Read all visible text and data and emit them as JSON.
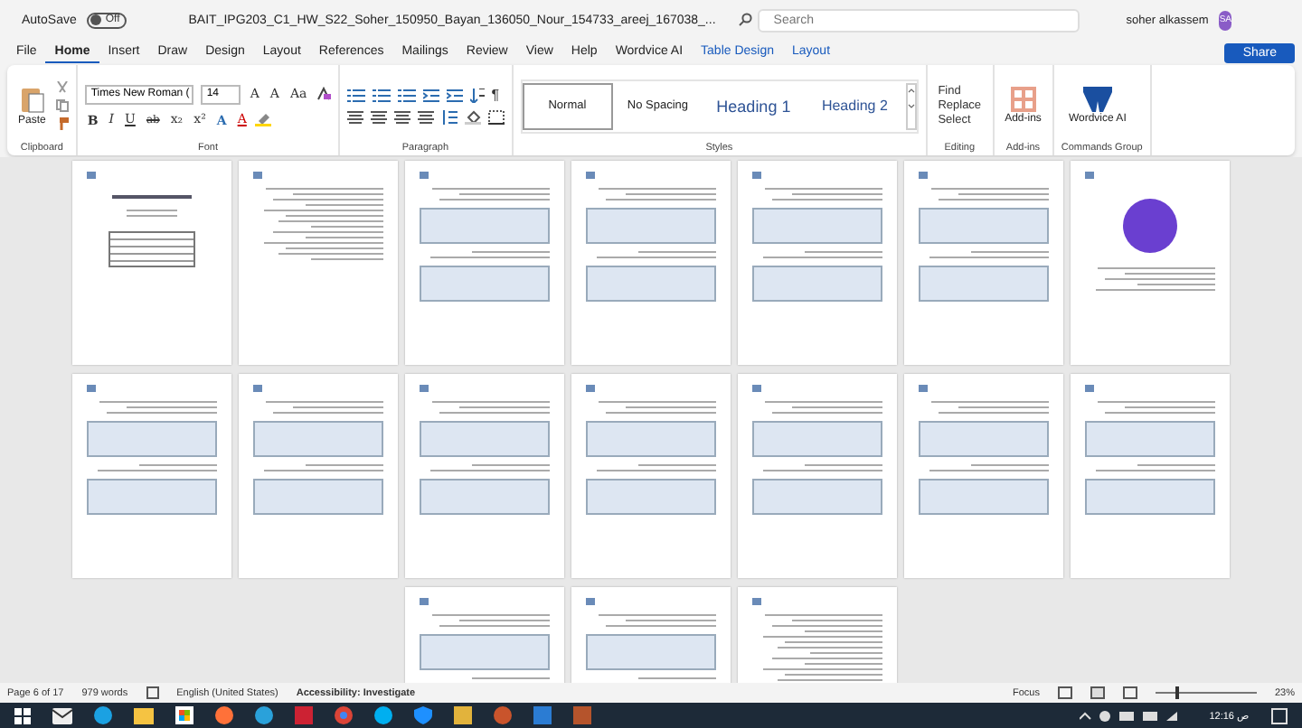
{
  "title_bar": {
    "autosave_label": "AutoSave",
    "autosave_on": false,
    "autosave_state": "Off",
    "filename": "BAIT_IPG203_C1_HW_S22_Soher_150950_Bayan_136050_Nour_154733_areej_167038_...",
    "search_placeholder": "Search",
    "user_name": "soher alkassem",
    "user_initials": "SA"
  },
  "tabs": [
    {
      "label": "File",
      "selected": false,
      "kind": "normal"
    },
    {
      "label": "Home",
      "selected": true,
      "kind": "normal"
    },
    {
      "label": "Insert",
      "selected": false,
      "kind": "normal"
    },
    {
      "label": "Draw",
      "selected": false,
      "kind": "normal"
    },
    {
      "label": "Design",
      "selected": false,
      "kind": "normal"
    },
    {
      "label": "Layout",
      "selected": false,
      "kind": "normal"
    },
    {
      "label": "References",
      "selected": false,
      "kind": "normal"
    },
    {
      "label": "Mailings",
      "selected": false,
      "kind": "normal"
    },
    {
      "label": "Review",
      "selected": false,
      "kind": "normal"
    },
    {
      "label": "View",
      "selected": false,
      "kind": "normal"
    },
    {
      "label": "Help",
      "selected": false,
      "kind": "normal"
    },
    {
      "label": "Wordvice AI",
      "selected": false,
      "kind": "normal"
    },
    {
      "label": "Table Design",
      "selected": false,
      "kind": "contextual"
    },
    {
      "label": "Layout",
      "selected": false,
      "kind": "contextual"
    }
  ],
  "share_label": "Share",
  "ribbon": {
    "clipboard": {
      "paste": "Paste",
      "group": "Clipboard"
    },
    "font": {
      "font_name": "Times New Roman (",
      "font_size": "14",
      "row1": [
        "A",
        "A",
        "Aa"
      ],
      "row2": [
        "B",
        "I",
        "U",
        "ab",
        "x₂",
        "x²",
        "A",
        "A"
      ],
      "group": "Font"
    },
    "paragraph": {
      "pilcrow": "¶",
      "group": "Paragraph"
    },
    "styles": {
      "items": [
        {
          "label": "Normal",
          "kind": "normal",
          "selected": true
        },
        {
          "label": "No Spacing",
          "kind": "normal",
          "selected": false
        },
        {
          "label": "Heading 1",
          "kind": "heading1",
          "selected": false
        },
        {
          "label": "Heading 2",
          "kind": "heading2",
          "selected": false
        }
      ],
      "group": "Styles"
    },
    "editing": {
      "items": [
        "Find",
        "Replace",
        "Select"
      ],
      "group": "Editing"
    },
    "addins": {
      "label": "Add-ins",
      "group": "Add-ins"
    },
    "wordvice": {
      "label": "Wordvice AI",
      "group": "Commands Group"
    }
  },
  "document": {
    "page_rows": [
      {
        "pages": [
          {
            "kind": "cover"
          },
          {
            "kind": "text"
          },
          {
            "kind": "screenshot"
          },
          {
            "kind": "screenshot"
          },
          {
            "kind": "screenshot"
          },
          {
            "kind": "screenshot"
          },
          {
            "kind": "chart"
          }
        ]
      },
      {
        "pages": [
          {
            "kind": "screenshot"
          },
          {
            "kind": "screenshot"
          },
          {
            "kind": "screenshot"
          },
          {
            "kind": "screenshot"
          },
          {
            "kind": "screenshot"
          },
          {
            "kind": "screenshot"
          },
          {
            "kind": "screenshot"
          }
        ]
      },
      {
        "pages": [
          {
            "kind": "screenshot"
          },
          {
            "kind": "screenshot"
          },
          {
            "kind": "text"
          }
        ]
      }
    ]
  },
  "status_bar": {
    "page": "Page 6 of 17",
    "words": "979 words",
    "language": "English (United States)",
    "accessibility": "Accessibility: Investigate",
    "focus": "Focus",
    "level": 0.2,
    "zoom": "23%"
  },
  "taskbar": {
    "time": "12:16 ص"
  }
}
